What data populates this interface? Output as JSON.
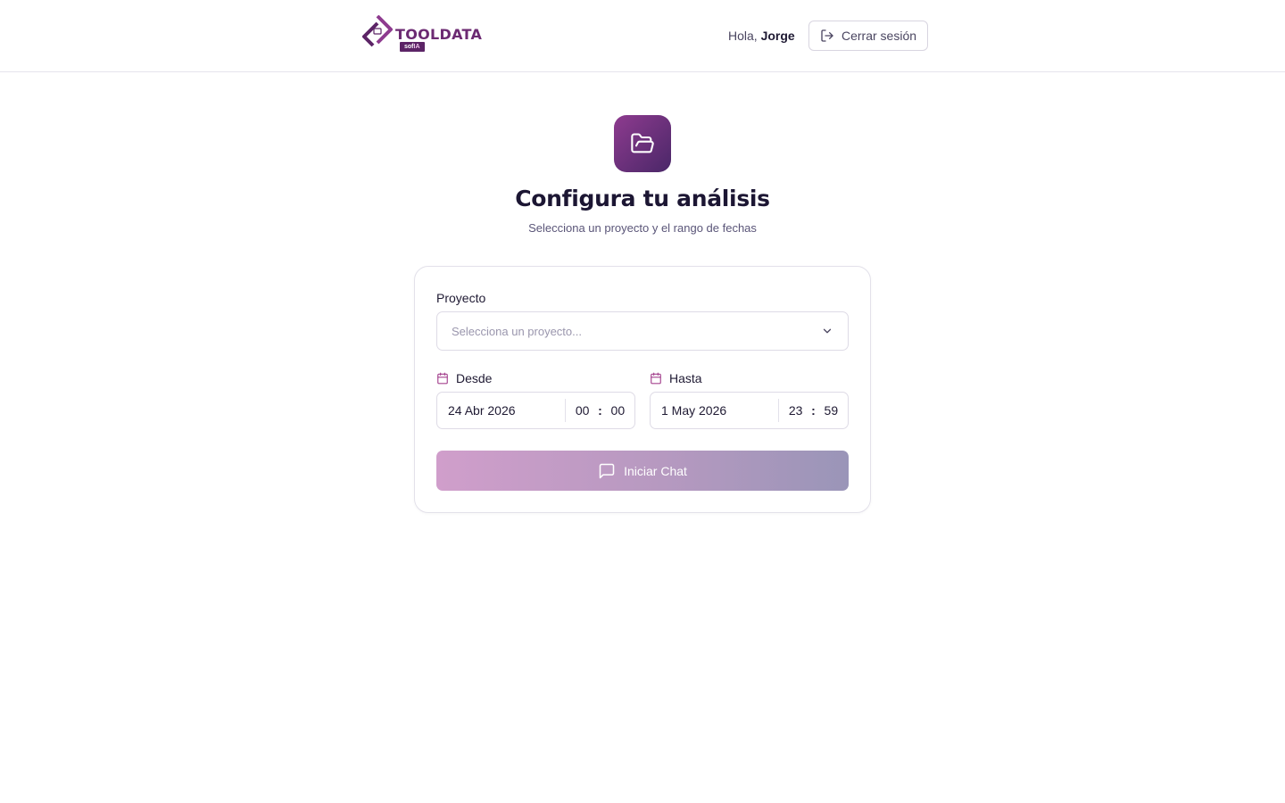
{
  "header": {
    "logo": {
      "brand": "TOOLDATA",
      "badge_prefix": "sof",
      "badge_suffix": "IA"
    },
    "greeting_prefix": "Hola,",
    "user_name": "Jorge",
    "logout_label": "Cerrar sesión"
  },
  "main": {
    "title": "Configura tu análisis",
    "subtitle": "Selecciona un proyecto y el rango de fechas"
  },
  "form": {
    "project_label": "Proyecto",
    "project_placeholder": "Selecciona un proyecto...",
    "from": {
      "label": "Desde",
      "date": "24 Abr 2026",
      "hour": "00",
      "minute": "00"
    },
    "to": {
      "label": "Hasta",
      "date": "1 May 2026",
      "hour": "23",
      "minute": "59"
    },
    "time_separator": ":",
    "submit_label": "Iniciar Chat"
  },
  "icons": {
    "hero": "folder-open-icon",
    "logout": "logout-icon",
    "calendar": "calendar-icon",
    "chevron": "chevron-down-icon",
    "chat": "chat-bubble-icon"
  },
  "colors": {
    "brand": "#6c2a72",
    "accent": "#8e3b8f",
    "button_start": "#d09ecb",
    "button_end": "#9a95b8"
  }
}
